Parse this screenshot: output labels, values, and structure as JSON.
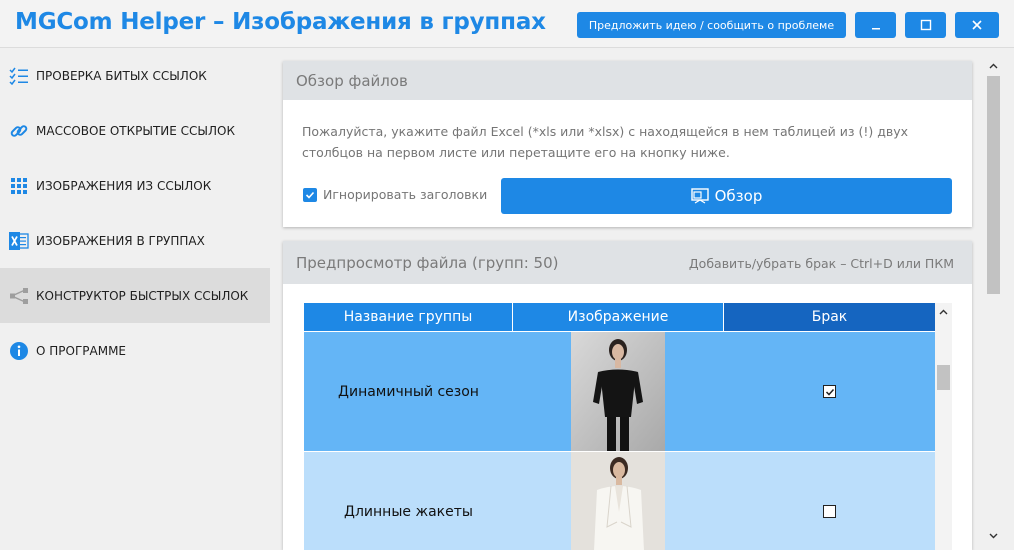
{
  "window": {
    "title": "MGCom Helper – Изображения в группах",
    "feedback_label": "Предложить идею / сообщить о проблеме",
    "minimize_glyph": "_",
    "maximize_glyph": "☐",
    "close_glyph": "✕"
  },
  "sidebar": {
    "items": [
      {
        "label": "Проверка битых ссылок",
        "icon": "checklist-icon"
      },
      {
        "label": "Массовое открытие ссылок",
        "icon": "link-icon"
      },
      {
        "label": "Изображения из ссылок",
        "icon": "grid-dots-icon"
      },
      {
        "label": "Изображения в группах",
        "icon": "excel-icon"
      },
      {
        "label": "Конструктор быстрых ссылок",
        "icon": "share-nodes-icon",
        "active": true
      },
      {
        "label": "О программе",
        "icon": "info-icon"
      }
    ]
  },
  "files_panel": {
    "title": "Обзор файлов",
    "hint": "Пожалуйста, укажите файл Excel (*xls или *xlsx) с находящейся в нем таблицей из (!) двух столбцов на первом листе или перетащите его на кнопку ниже.",
    "ignore_headers_label": "Игнорировать заголовки",
    "ignore_headers_checked": true,
    "browse_label": "Обзор"
  },
  "preview_panel": {
    "title": "Предпросмотр файла (групп: 50)",
    "hotkey_hint": "Добавить/убрать брак – Ctrl+D или ПКМ",
    "columns": [
      "Название группы",
      "Изображение",
      "Брак"
    ],
    "rows": [
      {
        "name": "Динамичный сезон",
        "image": "woman-black-suit-photo",
        "defect": true
      },
      {
        "name": "Длинные жакеты",
        "image": "woman-white-jacket-photo",
        "defect": false
      }
    ]
  },
  "colors": {
    "accent": "#1e88e5",
    "header_dark": "#1565c0",
    "row_selected": "#64b5f6",
    "row_light": "#bbdefb"
  }
}
